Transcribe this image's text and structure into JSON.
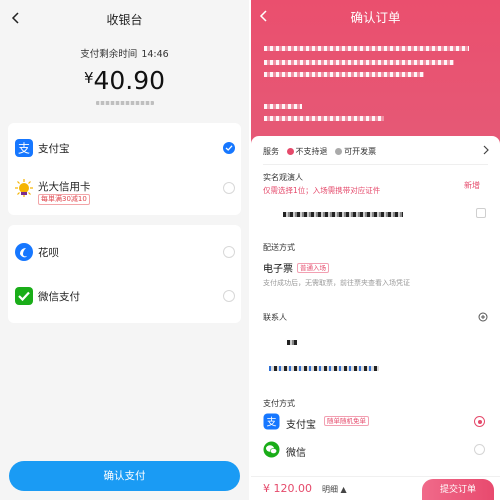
{
  "cashier": {
    "title": "收银台",
    "remaining_label": "支付剩余时间",
    "remaining_time": "14:46",
    "currency_symbol": "¥",
    "amount": "40.90",
    "methods": [
      {
        "label": "支付宝",
        "icon": "alipay-icon",
        "selected": true
      },
      {
        "label": "光大信用卡",
        "icon": "cebbank-icon",
        "badge": "每単满30减10",
        "selected": false
      },
      {
        "label": "花呗",
        "icon": "huabei-icon",
        "selected": false
      },
      {
        "label": "微信支付",
        "icon": "wechat-pay-icon",
        "selected": false
      }
    ],
    "confirm_button": "确认支付",
    "colors": {
      "accent": "#1677ff",
      "button": "#1a9bf4"
    }
  },
  "order": {
    "title": "确认订单",
    "service_label": "服务",
    "service_items": [
      "不支持退",
      "可开发票"
    ],
    "realname_label": "实名观演人",
    "realname_tip": "仅需选择1位；入场需携带对应证件",
    "add_link": "新增",
    "delivery_label": "配送方式",
    "eticket": "电子票",
    "eticket_tag": "普通入场",
    "eticket_note": "支付成功后，无需取票，前往票夹查看入场凭证",
    "contact_label": "联系人",
    "payment_label": "支付方式",
    "payments": [
      {
        "label": "支付宝",
        "icon": "alipay-icon",
        "tag": "随单随机免单",
        "selected": true
      },
      {
        "label": "微信",
        "icon": "wechat-icon",
        "selected": false
      }
    ],
    "price": "¥ 120.00",
    "detail_link": "明细",
    "submit_button": "提交订单",
    "colors": {
      "accent": "#e54a6b",
      "header": "#ea4f6e"
    }
  }
}
